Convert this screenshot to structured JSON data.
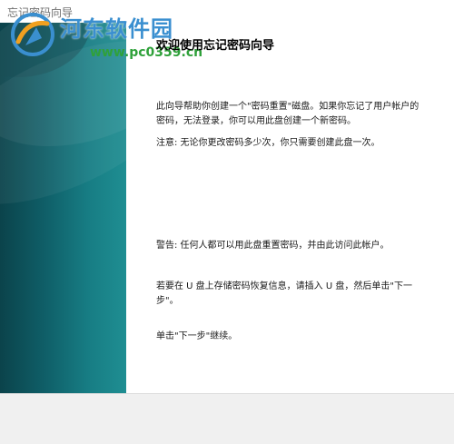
{
  "window": {
    "title": "忘记密码向导"
  },
  "watermark": {
    "site_name": "河东软件园",
    "url": "www.pc0359.cn"
  },
  "content": {
    "heading": "欢迎使用忘记密码向导",
    "intro": "此向导帮助你创建一个\"密码重置\"磁盘。如果你忘记了用户帐户的密码，无法登录，你可以用此盘创建一个新密码。",
    "note": "注意: 无论你更改密码多少次，你只需要创建此盘一次。",
    "warning": "警告: 任何人都可以用此盘重置密码，并由此访问此帐户。",
    "insert_instruction": "若要在 U 盘上存储密码恢复信息，请插入 U 盘，然后单击\"下一步\"。",
    "continue_instruction": "单击\"下一步\"继续。"
  },
  "colors": {
    "sidebar_dark": "#0b434b",
    "sidebar_light": "#1f8e92",
    "watermark_blue": "#3a8fd0",
    "watermark_green": "#2fa13a",
    "bottom_bar": "#f0f0f0"
  },
  "icons": {
    "watermark_logo": "site-logo-icon"
  }
}
